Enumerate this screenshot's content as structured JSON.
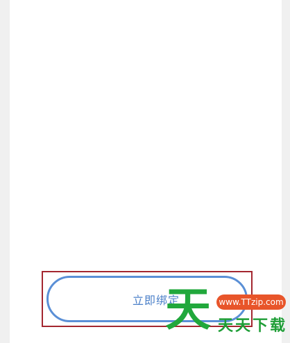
{
  "bind_button": {
    "label": "立即绑定"
  },
  "watermark": {
    "big_glyph": "天",
    "url": "www.TTzip.com",
    "site_name": "天天下载"
  },
  "colors": {
    "button_border": "#5a8fd6",
    "button_text": "#4a7fc8",
    "highlight_border": "#a3262f",
    "watermark_green": "#21a83c",
    "watermark_pill": "#e8552a"
  }
}
